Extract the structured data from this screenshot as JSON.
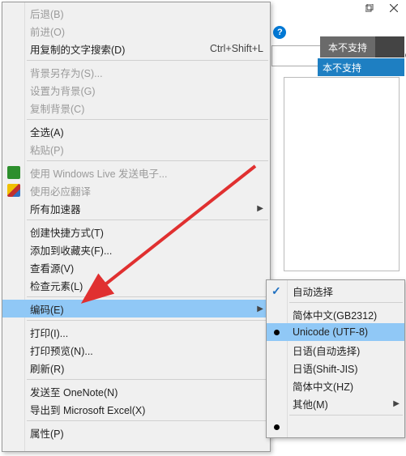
{
  "titlebar": {
    "restore": "restore",
    "close": "close"
  },
  "toolbar": {
    "help": "?"
  },
  "tab": {
    "label": "本不支持"
  },
  "search": {
    "placeholder": ""
  },
  "unsupported": {
    "text": "本不支持"
  },
  "menu": {
    "items": [
      {
        "label": "后退(B)",
        "disabled": true
      },
      {
        "label": "前进(O)",
        "disabled": true
      },
      {
        "label": "用复制的文字搜索(D)",
        "shortcut": "Ctrl+Shift+L"
      },
      "sep",
      {
        "label": "背景另存为(S)...",
        "disabled": true
      },
      {
        "label": "设置为背景(G)",
        "disabled": true
      },
      {
        "label": "复制背景(C)",
        "disabled": true
      },
      "sep",
      {
        "label": "全选(A)"
      },
      {
        "label": "粘贴(P)",
        "disabled": true
      },
      "sep",
      {
        "label": "使用 Windows Live 发送电子...",
        "disabled": true,
        "icon": "green-box"
      },
      {
        "label": "使用必应翻译",
        "disabled": true,
        "icon": "colors"
      },
      {
        "label": "所有加速器",
        "submenu": true
      },
      "sep",
      {
        "label": "创建快捷方式(T)"
      },
      {
        "label": "添加到收藏夹(F)..."
      },
      {
        "label": "查看源(V)"
      },
      {
        "label": "检查元素(L)"
      },
      "sep",
      {
        "label": "编码(E)",
        "submenu": true,
        "highlight": true
      },
      "sep",
      {
        "label": "打印(I)..."
      },
      {
        "label": "打印预览(N)..."
      },
      {
        "label": "刷新(R)"
      },
      "sep",
      {
        "label": "发送至 OneNote(N)"
      },
      {
        "label": "导出到 Microsoft Excel(X)"
      },
      "sep",
      {
        "label": "属性(P)"
      }
    ]
  },
  "submenu": {
    "items": [
      {
        "label": "自动选择",
        "checked": true
      },
      "sep",
      {
        "label": "简体中文(GB2312)"
      },
      {
        "label": "Unicode (UTF-8)",
        "radio": true,
        "highlight": true
      },
      {
        "label": "日语(自动选择)"
      },
      {
        "label": "日语(Shift-JIS)"
      },
      {
        "label": "简体中文(HZ)"
      },
      {
        "label": "其他(M)",
        "submenu": true
      },
      "sep",
      {
        "label": "",
        "radio": true
      }
    ]
  }
}
